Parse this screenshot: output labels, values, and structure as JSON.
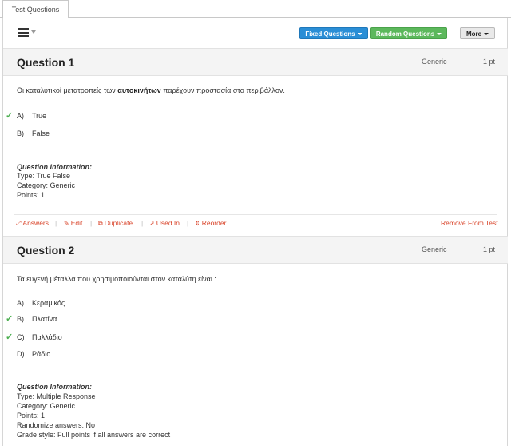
{
  "tab": {
    "label": "Test Questions"
  },
  "toolbar": {
    "fixed_label": "Fixed Questions",
    "random_label": "Random Questions",
    "more_label": "More"
  },
  "questions": [
    {
      "title": "Question 1",
      "category": "Generic",
      "points": "1 pt",
      "text_before": "Οι καταλυτικοί μετατροπείς των ",
      "text_bold": "αυτοκινήτων",
      "text_after": " παρέχουν προστασία στο περιβάλλον.",
      "answers": [
        {
          "letter": "A)",
          "text": "True",
          "correct": true
        },
        {
          "letter": "B)",
          "text": "False",
          "correct": false
        }
      ],
      "info_heading": "Question Information:",
      "info": [
        "Type: True False",
        "Category: Generic",
        "Points: 1"
      ],
      "actions": {
        "answers": "Answers",
        "edit": "Edit",
        "duplicate": "Duplicate",
        "used_in": "Used In",
        "reorder": "Reorder",
        "remove": "Remove From Test"
      }
    },
    {
      "title": "Question 2",
      "category": "Generic",
      "points": "1 pt",
      "text": "Τα ευγενή μέταλλα που χρησιμοποιούνται στον καταλύτη είναι :",
      "answers": [
        {
          "letter": "A)",
          "text": "Κεραμικός",
          "correct": false
        },
        {
          "letter": "B)",
          "text": "Πλατίνα",
          "correct": true
        },
        {
          "letter": "C)",
          "text": "Παλλάδιο",
          "correct": true
        },
        {
          "letter": "D)",
          "text": "Ράδιο",
          "correct": false
        }
      ],
      "info_heading": "Question Information:",
      "info": [
        "Type: Multiple Response",
        "Category: Generic",
        "Points: 1",
        "Randomize answers: No",
        "Grade style: Full points if all answers are correct"
      ]
    }
  ]
}
